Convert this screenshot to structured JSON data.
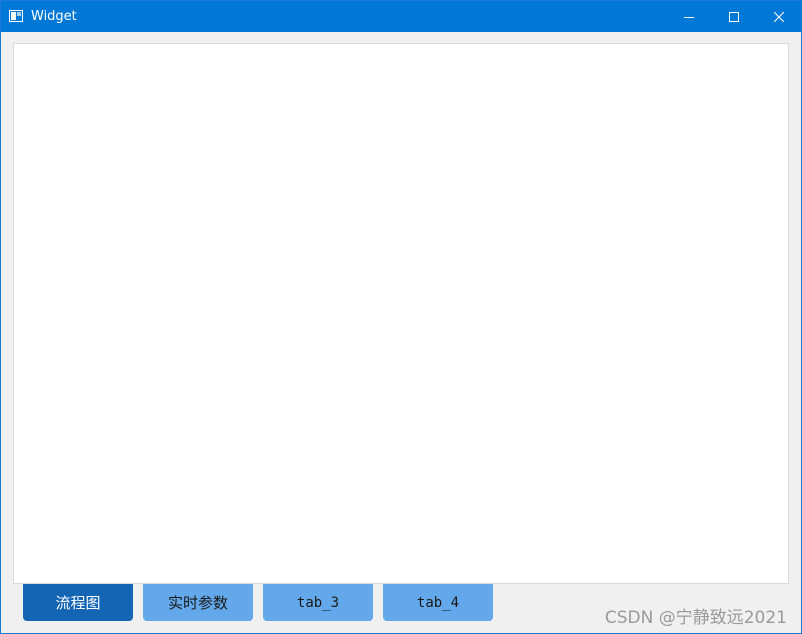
{
  "window": {
    "title": "Widget",
    "controls": {
      "minimize_icon": "minimize-icon",
      "maximize_icon": "maximize-icon",
      "close_icon": "close-icon"
    },
    "accent_color": "#0078d7"
  },
  "tabs": [
    {
      "label": "流程图",
      "selected": true
    },
    {
      "label": "实时参数",
      "selected": false
    },
    {
      "label": "tab_3",
      "selected": false
    },
    {
      "label": "tab_4",
      "selected": false
    }
  ],
  "tab_colors": {
    "selected": "#1565b5",
    "unselected": "#62a8ea"
  },
  "watermark": "CSDN @宁静致远2021"
}
